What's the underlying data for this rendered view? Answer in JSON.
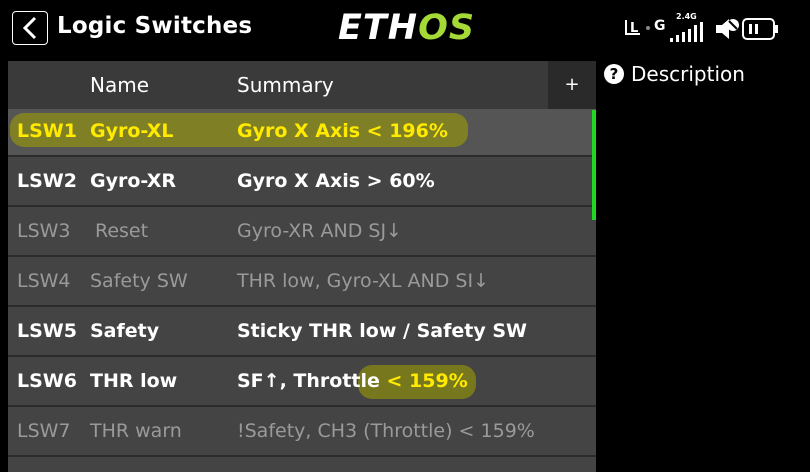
{
  "header": {
    "title": "Logic Switches",
    "logo_left": "ETH",
    "logo_right": "OS",
    "status": {
      "left_l": "L",
      "left_g": "G",
      "band": "2.4G"
    }
  },
  "table": {
    "columns": [
      "Name",
      "Summary"
    ],
    "add_label": "+",
    "rows": [
      {
        "id": "LSW1",
        "name": "Gyro-XL",
        "summary": "Gyro X Axis < 196%",
        "active": true,
        "highlighted": true
      },
      {
        "id": "LSW2",
        "name": "Gyro-XR",
        "summary": "Gyro X Axis > 60%",
        "active": true,
        "highlighted": false
      },
      {
        "id": "LSW3",
        "name": "Reset",
        "summary": "Gyro-XR AND SJ↓",
        "active": false,
        "highlighted": false
      },
      {
        "id": "LSW4",
        "name": "Safety SW",
        "summary": "THR low, Gyro-XL AND SI↓",
        "active": false,
        "highlighted": false
      },
      {
        "id": "LSW5",
        "name": "Safety",
        "summary": "Sticky THR low / Safety SW",
        "active": true,
        "highlighted": false
      },
      {
        "id": "LSW6",
        "name": "THR low",
        "summary_a": "SF↑, Throttle",
        "summary_b": " < 159%",
        "active": true,
        "highlighted": "partial"
      },
      {
        "id": "LSW7",
        "name": "THR warn",
        "summary": "!Safety, CH3 (Throttle) < 159%",
        "active": false,
        "highlighted": false
      }
    ]
  },
  "panel": {
    "description_label": "Description",
    "help_icon": "?"
  },
  "colors": {
    "accent_green": "#a5d936",
    "highlight_yellow": "#ffea00",
    "scroll_green": "#24d624"
  }
}
